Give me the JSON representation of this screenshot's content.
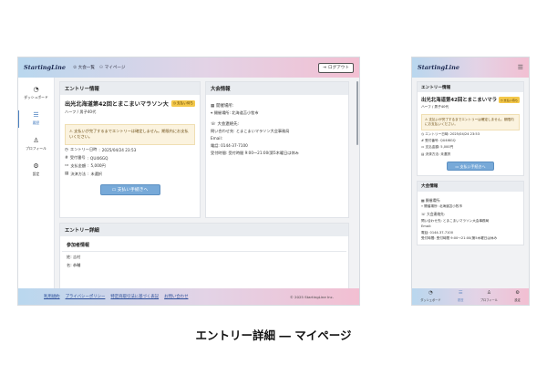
{
  "app": {
    "logo": "StartingLine"
  },
  "header": {
    "nav": [
      {
        "label": "大会一覧",
        "icon": "trophy-icon"
      },
      {
        "label": "マイページ",
        "icon": "user-icon"
      }
    ],
    "logout_label": "ログアウト"
  },
  "sidebar": {
    "items": [
      {
        "label": "ダッシュボード",
        "icon": "dashboard-icon",
        "active": false
      },
      {
        "label": "履歴",
        "icon": "list-icon",
        "active": true
      },
      {
        "label": "プロフィール",
        "icon": "person-icon",
        "active": false
      },
      {
        "label": "設定",
        "icon": "gear-icon",
        "active": false
      }
    ]
  },
  "entry_info": {
    "heading": "エントリー情報",
    "event_title": "出光北海道第42回とまこまいマラソン大",
    "status_badge": "支払い待ち",
    "category": "ハーフ / 男子40代",
    "warning": "支払いが完了するまでエントリーは確定しません。期限内にお支払いください。",
    "fields": [
      {
        "label": "エントリー日時",
        "value": "2025/04/24 23:53"
      },
      {
        "label": "受付番号",
        "value": "QU4l6GQ"
      },
      {
        "label": "支払金額",
        "value": "5,000円"
      },
      {
        "label": "決済方法",
        "value": "未選択"
      }
    ],
    "pay_button": "支払い手続きへ"
  },
  "event_info": {
    "heading": "大会情報",
    "venue_label": "開催場所:",
    "venue_value": "開催場所: 北海道苫小牧市",
    "contact_label": "大会連絡先:",
    "contact_lines": [
      "問い合わせ先: とまこまいマラソン大会事務局",
      "Email:",
      "電話: 0144-37-7100",
      "受付時間: 受付時間 9:00～21:00(第5木曜日は休み"
    ]
  },
  "entry_detail": {
    "heading": "エントリー詳細",
    "participant_heading": "参加者情報",
    "fields": [
      {
        "label": "姓",
        "value": "吉村"
      },
      {
        "label": "名",
        "value": "恭輔"
      }
    ]
  },
  "footer": {
    "links": [
      "利用規約",
      "プライバシーポリシー",
      "特定商取引法に基づく表記",
      "お問い合わせ"
    ],
    "copyright": "© 2025 StartingLine Inc."
  },
  "mobile": {
    "entry_title": "出光北海道第42回とまこまいマラ",
    "venue_value": "開催場所: 北海道苫小牧市",
    "contact_lines": [
      "問い合わせ先: とまこまいマラソン大会事務局",
      "Email:",
      "電話: 0144-37-7100",
      "受付時間: 受付時間 9:00～21:00(第5木曜日は休み"
    ],
    "tabs": [
      {
        "label": "ダッシュボード",
        "icon": "dashboard-icon",
        "active": false
      },
      {
        "label": "履歴",
        "icon": "list-icon",
        "active": true
      },
      {
        "label": "プロフィール",
        "icon": "person-icon",
        "active": false
      },
      {
        "label": "設定",
        "icon": "gear-icon",
        "active": false
      }
    ]
  },
  "caption": "エントリー詳細 ― マイページ",
  "colors": {
    "header_left": "#b9d7ee",
    "header_right": "#f2bfd2",
    "accent_blue": "#77a9d8",
    "badge_yellow": "#f4c84a",
    "warning_bg": "#fbf3df"
  }
}
